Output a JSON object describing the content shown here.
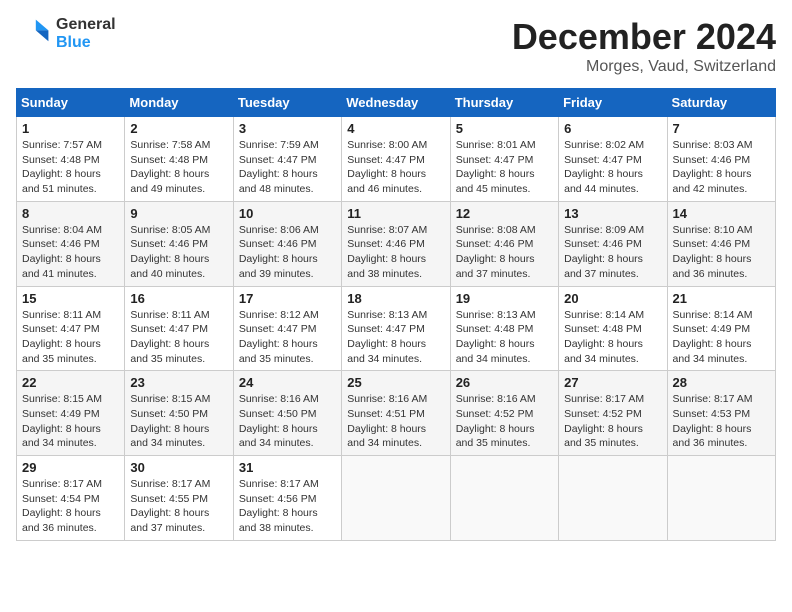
{
  "logo": {
    "line1": "General",
    "line2": "Blue"
  },
  "title": "December 2024",
  "location": "Morges, Vaud, Switzerland",
  "days_header": [
    "Sunday",
    "Monday",
    "Tuesday",
    "Wednesday",
    "Thursday",
    "Friday",
    "Saturday"
  ],
  "weeks": [
    [
      {
        "day": "1",
        "sunrise": "7:57 AM",
        "sunset": "4:48 PM",
        "daylight": "8 hours and 51 minutes."
      },
      {
        "day": "2",
        "sunrise": "7:58 AM",
        "sunset": "4:48 PM",
        "daylight": "8 hours and 49 minutes."
      },
      {
        "day": "3",
        "sunrise": "7:59 AM",
        "sunset": "4:47 PM",
        "daylight": "8 hours and 48 minutes."
      },
      {
        "day": "4",
        "sunrise": "8:00 AM",
        "sunset": "4:47 PM",
        "daylight": "8 hours and 46 minutes."
      },
      {
        "day": "5",
        "sunrise": "8:01 AM",
        "sunset": "4:47 PM",
        "daylight": "8 hours and 45 minutes."
      },
      {
        "day": "6",
        "sunrise": "8:02 AM",
        "sunset": "4:47 PM",
        "daylight": "8 hours and 44 minutes."
      },
      {
        "day": "7",
        "sunrise": "8:03 AM",
        "sunset": "4:46 PM",
        "daylight": "8 hours and 42 minutes."
      }
    ],
    [
      {
        "day": "8",
        "sunrise": "8:04 AM",
        "sunset": "4:46 PM",
        "daylight": "8 hours and 41 minutes."
      },
      {
        "day": "9",
        "sunrise": "8:05 AM",
        "sunset": "4:46 PM",
        "daylight": "8 hours and 40 minutes."
      },
      {
        "day": "10",
        "sunrise": "8:06 AM",
        "sunset": "4:46 PM",
        "daylight": "8 hours and 39 minutes."
      },
      {
        "day": "11",
        "sunrise": "8:07 AM",
        "sunset": "4:46 PM",
        "daylight": "8 hours and 38 minutes."
      },
      {
        "day": "12",
        "sunrise": "8:08 AM",
        "sunset": "4:46 PM",
        "daylight": "8 hours and 37 minutes."
      },
      {
        "day": "13",
        "sunrise": "8:09 AM",
        "sunset": "4:46 PM",
        "daylight": "8 hours and 37 minutes."
      },
      {
        "day": "14",
        "sunrise": "8:10 AM",
        "sunset": "4:46 PM",
        "daylight": "8 hours and 36 minutes."
      }
    ],
    [
      {
        "day": "15",
        "sunrise": "8:11 AM",
        "sunset": "4:47 PM",
        "daylight": "8 hours and 35 minutes."
      },
      {
        "day": "16",
        "sunrise": "8:11 AM",
        "sunset": "4:47 PM",
        "daylight": "8 hours and 35 minutes."
      },
      {
        "day": "17",
        "sunrise": "8:12 AM",
        "sunset": "4:47 PM",
        "daylight": "8 hours and 35 minutes."
      },
      {
        "day": "18",
        "sunrise": "8:13 AM",
        "sunset": "4:47 PM",
        "daylight": "8 hours and 34 minutes."
      },
      {
        "day": "19",
        "sunrise": "8:13 AM",
        "sunset": "4:48 PM",
        "daylight": "8 hours and 34 minutes."
      },
      {
        "day": "20",
        "sunrise": "8:14 AM",
        "sunset": "4:48 PM",
        "daylight": "8 hours and 34 minutes."
      },
      {
        "day": "21",
        "sunrise": "8:14 AM",
        "sunset": "4:49 PM",
        "daylight": "8 hours and 34 minutes."
      }
    ],
    [
      {
        "day": "22",
        "sunrise": "8:15 AM",
        "sunset": "4:49 PM",
        "daylight": "8 hours and 34 minutes."
      },
      {
        "day": "23",
        "sunrise": "8:15 AM",
        "sunset": "4:50 PM",
        "daylight": "8 hours and 34 minutes."
      },
      {
        "day": "24",
        "sunrise": "8:16 AM",
        "sunset": "4:50 PM",
        "daylight": "8 hours and 34 minutes."
      },
      {
        "day": "25",
        "sunrise": "8:16 AM",
        "sunset": "4:51 PM",
        "daylight": "8 hours and 34 minutes."
      },
      {
        "day": "26",
        "sunrise": "8:16 AM",
        "sunset": "4:52 PM",
        "daylight": "8 hours and 35 minutes."
      },
      {
        "day": "27",
        "sunrise": "8:17 AM",
        "sunset": "4:52 PM",
        "daylight": "8 hours and 35 minutes."
      },
      {
        "day": "28",
        "sunrise": "8:17 AM",
        "sunset": "4:53 PM",
        "daylight": "8 hours and 36 minutes."
      }
    ],
    [
      {
        "day": "29",
        "sunrise": "8:17 AM",
        "sunset": "4:54 PM",
        "daylight": "8 hours and 36 minutes."
      },
      {
        "day": "30",
        "sunrise": "8:17 AM",
        "sunset": "4:55 PM",
        "daylight": "8 hours and 37 minutes."
      },
      {
        "day": "31",
        "sunrise": "8:17 AM",
        "sunset": "4:56 PM",
        "daylight": "8 hours and 38 minutes."
      },
      null,
      null,
      null,
      null
    ]
  ],
  "labels": {
    "sunrise": "Sunrise:",
    "sunset": "Sunset:",
    "daylight": "Daylight:"
  }
}
